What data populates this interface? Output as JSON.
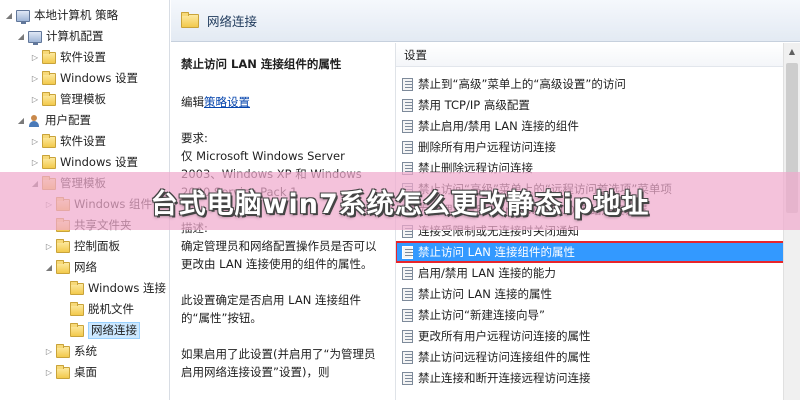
{
  "tree": {
    "items": [
      {
        "label": "本地计算机 策略",
        "icon": "computer-policy-icon",
        "twisty": "◢"
      },
      {
        "label": "计算机配置",
        "icon": "computer-icon",
        "twisty": "◢"
      },
      {
        "label": "软件设置",
        "icon": "folder-icon",
        "twisty": "▷"
      },
      {
        "label": "Windows 设置",
        "icon": "folder-icon",
        "twisty": "▷"
      },
      {
        "label": "管理模板",
        "icon": "folder-icon",
        "twisty": "▷"
      },
      {
        "label": "用户配置",
        "icon": "user-icon",
        "twisty": "◢"
      },
      {
        "label": "软件设置",
        "icon": "folder-icon",
        "twisty": "▷"
      },
      {
        "label": "Windows 设置",
        "icon": "folder-icon",
        "twisty": "▷"
      },
      {
        "label": "管理模板",
        "icon": "folder-icon",
        "twisty": "◢"
      },
      {
        "label": "Windows 组件",
        "icon": "folder-icon",
        "twisty": "▷"
      },
      {
        "label": "共享文件夹",
        "icon": "folder-icon",
        "twisty": ""
      },
      {
        "label": "控制面板",
        "icon": "folder-icon",
        "twisty": "▷"
      },
      {
        "label": "网络",
        "icon": "folder-icon",
        "twisty": "◢"
      },
      {
        "label": "Windows 连接",
        "icon": "folder-icon",
        "twisty": ""
      },
      {
        "label": "脱机文件",
        "icon": "folder-icon",
        "twisty": ""
      },
      {
        "label": "网络连接",
        "icon": "folder-icon",
        "twisty": "",
        "selected": true
      },
      {
        "label": "系统",
        "icon": "folder-icon",
        "twisty": "▷"
      },
      {
        "label": "桌面",
        "icon": "folder-icon",
        "twisty": "▷"
      }
    ]
  },
  "header": {
    "title": "网络连接"
  },
  "description": {
    "title": "禁止访问 LAN 连接组件的属性",
    "edit_prefix": "编辑",
    "edit_link": "策略设置",
    "req_label": "要求:",
    "req_text": "仅 Microsoft Windows Server 2003、Windows XP 和 Windows 2000 Service Pack 1",
    "desc_label": "描述:",
    "desc_text": "确定管理员和网络配置操作员是否可以更改由 LAN 连接使用的组件的属性。",
    "para2": "此设置确定是否启用 LAN 连接组件的“属性”按钮。",
    "para3": "如果启用了此设置(并启用了“为管理员启用网络连接设置”设置)，则"
  },
  "settings": {
    "column_header": "设置",
    "items": [
      {
        "label": "禁止到“高级”菜单上的“高级设置”的访问"
      },
      {
        "label": "禁用 TCP/IP 高级配置"
      },
      {
        "label": "禁止启用/禁用 LAN 连接的组件"
      },
      {
        "label": "删除所有用户远程访问连接"
      },
      {
        "label": "禁止删除远程访问连接"
      },
      {
        "label": "禁止访问“高级”菜单上的“远程访问首选项”菜单项"
      },
      {
        "label": "为管理员启用 Windows 2000 网络连接设置"
      },
      {
        "label": "连接受限制或无连接时关闭通知"
      },
      {
        "label": "禁止访问 LAN 连接组件的属性",
        "selected": true
      },
      {
        "label": "启用/禁用 LAN 连接的能力"
      },
      {
        "label": "禁止访问 LAN 连接的属性"
      },
      {
        "label": "禁止访问“新建连接向导”"
      },
      {
        "label": "更改所有用户远程访问连接的属性"
      },
      {
        "label": "禁止访问远程访问连接组件的属性"
      },
      {
        "label": "禁止连接和断开连接远程访问连接"
      }
    ]
  },
  "banner": {
    "text": "台式电脑win7系统怎么更改静态ip地址"
  },
  "colors": {
    "selection": "#3399ff",
    "highlight_border": "#e8252b",
    "banner_bg": "#f0aacd"
  }
}
